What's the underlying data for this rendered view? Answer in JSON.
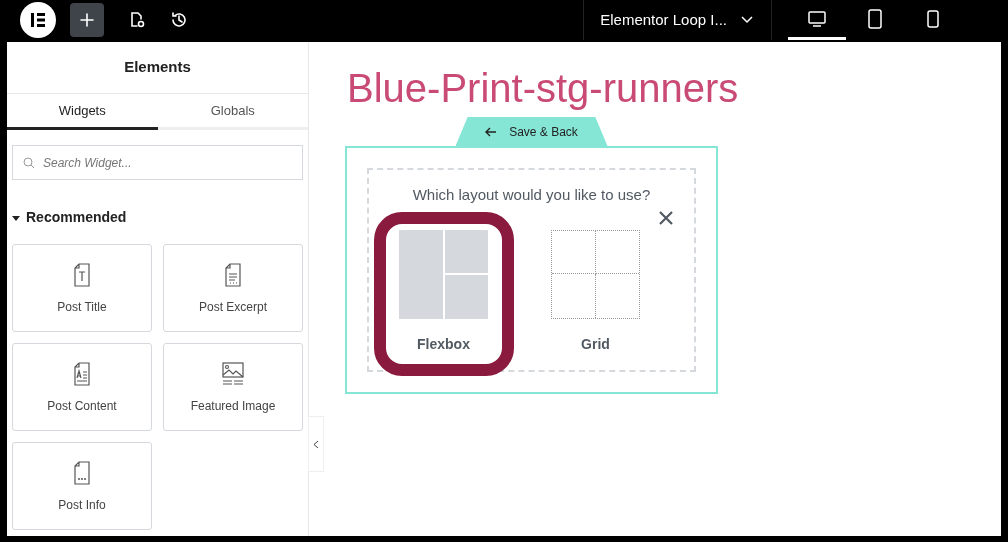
{
  "top_bar": {
    "tools": [
      {
        "kind": "add",
        "selected": true
      },
      {
        "kind": "page-settings",
        "selected": false
      },
      {
        "kind": "history",
        "selected": false
      }
    ],
    "document_title": "Elementor Loop I...",
    "devices": [
      {
        "kind": "desktop",
        "selected": true
      },
      {
        "kind": "tablet",
        "selected": false
      },
      {
        "kind": "mobile",
        "selected": false
      }
    ]
  },
  "sidebar": {
    "title": "Elements",
    "tabs": [
      {
        "label": "Widgets",
        "selected": true
      },
      {
        "label": "Globals",
        "selected": false
      }
    ],
    "search": {
      "placeholder": "Search Widget..."
    },
    "section": {
      "label": "Recommended",
      "expanded": true
    },
    "widgets": [
      {
        "kind": "title",
        "label": "Post Title"
      },
      {
        "kind": "excerpt",
        "label": "Post Excerpt"
      },
      {
        "kind": "content",
        "label": "Post Content"
      },
      {
        "kind": "image",
        "label": "Featured Image"
      },
      {
        "kind": "info",
        "label": "Post Info"
      }
    ]
  },
  "canvas": {
    "heading": "Blue-Print-stg-runners",
    "save_back": "Save & Back",
    "prompt": "Which layout would you like to use?",
    "layouts": [
      {
        "kind": "flexbox",
        "label": "Flexbox",
        "selected": true
      },
      {
        "kind": "grid",
        "label": "Grid",
        "selected": false
      }
    ]
  }
}
